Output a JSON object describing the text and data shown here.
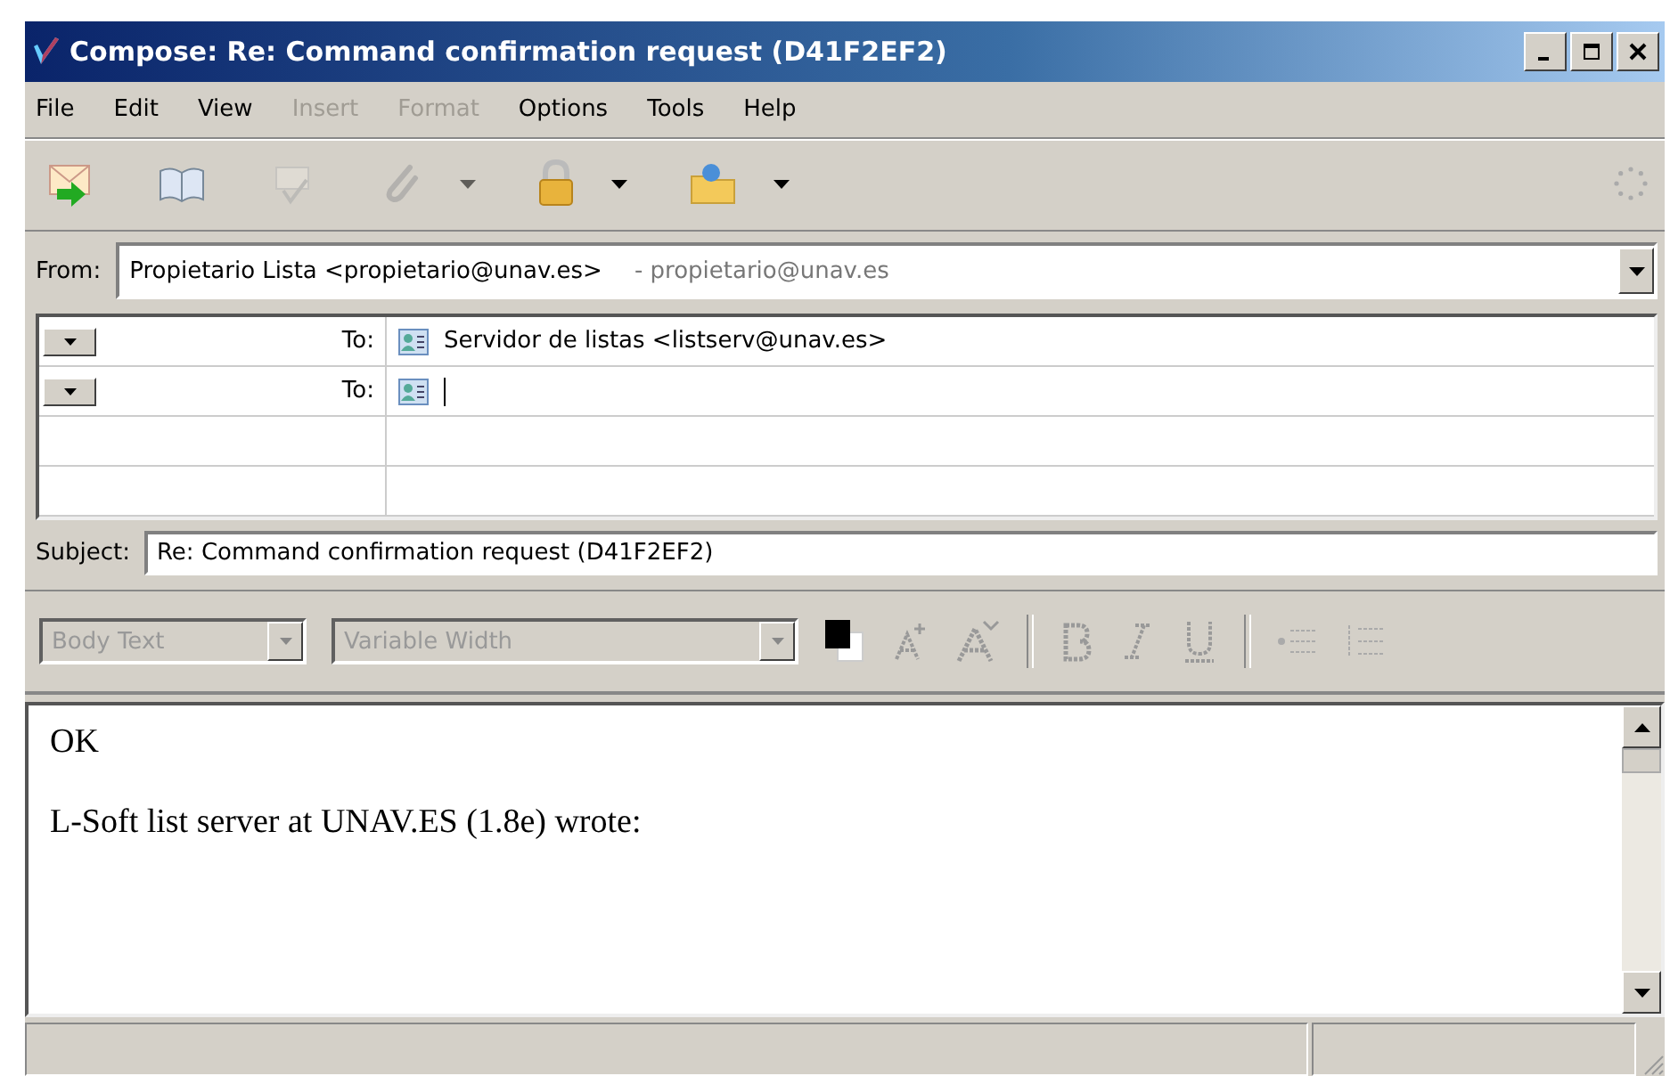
{
  "window": {
    "title": "Compose: Re: Command confirmation request (D41F2EF2)"
  },
  "menu": [
    {
      "label": "File",
      "disabled": false
    },
    {
      "label": "Edit",
      "disabled": false
    },
    {
      "label": "View",
      "disabled": false
    },
    {
      "label": "Insert",
      "disabled": true
    },
    {
      "label": "Format",
      "disabled": true
    },
    {
      "label": "Options",
      "disabled": false
    },
    {
      "label": "Tools",
      "disabled": false
    },
    {
      "label": "Help",
      "disabled": false
    }
  ],
  "toolbar": [
    {
      "kind": "send",
      "disabled": false,
      "dropdown": false
    },
    {
      "kind": "address",
      "disabled": false,
      "dropdown": false
    },
    {
      "kind": "spell",
      "disabled": true,
      "dropdown": false
    },
    {
      "kind": "attach",
      "disabled": true,
      "dropdown": true
    },
    {
      "kind": "security",
      "disabled": false,
      "dropdown": true
    },
    {
      "kind": "save",
      "disabled": false,
      "dropdown": true
    }
  ],
  "from": {
    "label": "From:",
    "name": "Propietario Lista <propietario@unav.es>",
    "account": "- propietario@unav.es"
  },
  "recipients": [
    {
      "kind": "recipient",
      "type": "To:",
      "value": "Servidor de listas <listserv@unav.es>"
    },
    {
      "kind": "recipient",
      "type": "To:"
    },
    {
      "kind": "empty"
    },
    {
      "kind": "empty"
    }
  ],
  "subject": {
    "label": "Subject:",
    "value": "Re: Command confirmation request (D41F2EF2)"
  },
  "format_toolbar": {
    "disabled": true,
    "paragraph_style": "Body Text",
    "font": "Variable Width"
  },
  "body": [
    "OK",
    "L-Soft list server at UNAV.ES (1.8e) wrote:"
  ]
}
